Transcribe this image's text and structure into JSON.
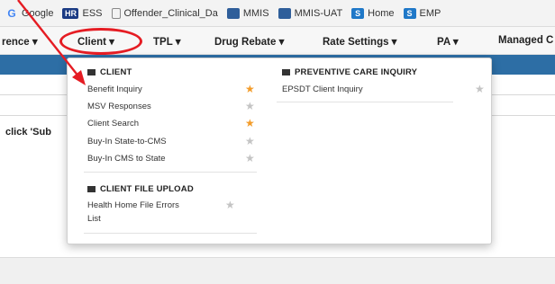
{
  "bookmarks": [
    {
      "icon": "google-icon",
      "glyph": "G",
      "label": "Google"
    },
    {
      "icon": "hr-icon",
      "glyph": "HR",
      "label": "ESS"
    },
    {
      "icon": "document-icon",
      "glyph": "",
      "label": "Offender_Clinical_Da"
    },
    {
      "icon": "mmis-icon",
      "glyph": "",
      "label": "MMIS"
    },
    {
      "icon": "mmis-uat-icon",
      "glyph": "",
      "label": "MMIS-UAT"
    },
    {
      "icon": "sharepoint-icon",
      "glyph": "S",
      "label": "Home"
    },
    {
      "icon": "sharepoint-icon",
      "glyph": "S",
      "label": "EMP"
    }
  ],
  "nav": {
    "reference": "rence ▾",
    "client": "Client ▾",
    "tpl": "TPL ▾",
    "drug_rebate": "Drug Rebate ▾",
    "rate_settings": "Rate Settings ▾",
    "pa": "PA ▾",
    "managed_care": "Managed C"
  },
  "content": {
    "instruction_fragment": "click 'Sub"
  },
  "dropdown": {
    "client_section": {
      "heading": "CLIENT",
      "items": [
        {
          "label": "Benefit Inquiry",
          "favorite": true
        },
        {
          "label": "MSV Responses",
          "favorite": false
        },
        {
          "label": "Client Search",
          "favorite": true
        },
        {
          "label": "Buy-In State-to-CMS",
          "favorite": false
        },
        {
          "label": "Buy-In CMS to State",
          "favorite": false
        }
      ]
    },
    "upload_section": {
      "heading": "CLIENT FILE UPLOAD",
      "items": [
        {
          "label_line1": "Health Home File Errors",
          "label_line2": "List",
          "favorite": false
        }
      ]
    },
    "preventive_section": {
      "heading": "PREVENTIVE CARE INQUIRY",
      "items": [
        {
          "label": "EPSDT Client Inquiry",
          "favorite": false
        }
      ]
    },
    "star_glyph": "★"
  },
  "colors": {
    "accent_blue": "#2d6ea5",
    "favorite_star": "#f39c2a",
    "inactive_star": "#c4c4c4",
    "annotation_red": "#e51c23"
  }
}
